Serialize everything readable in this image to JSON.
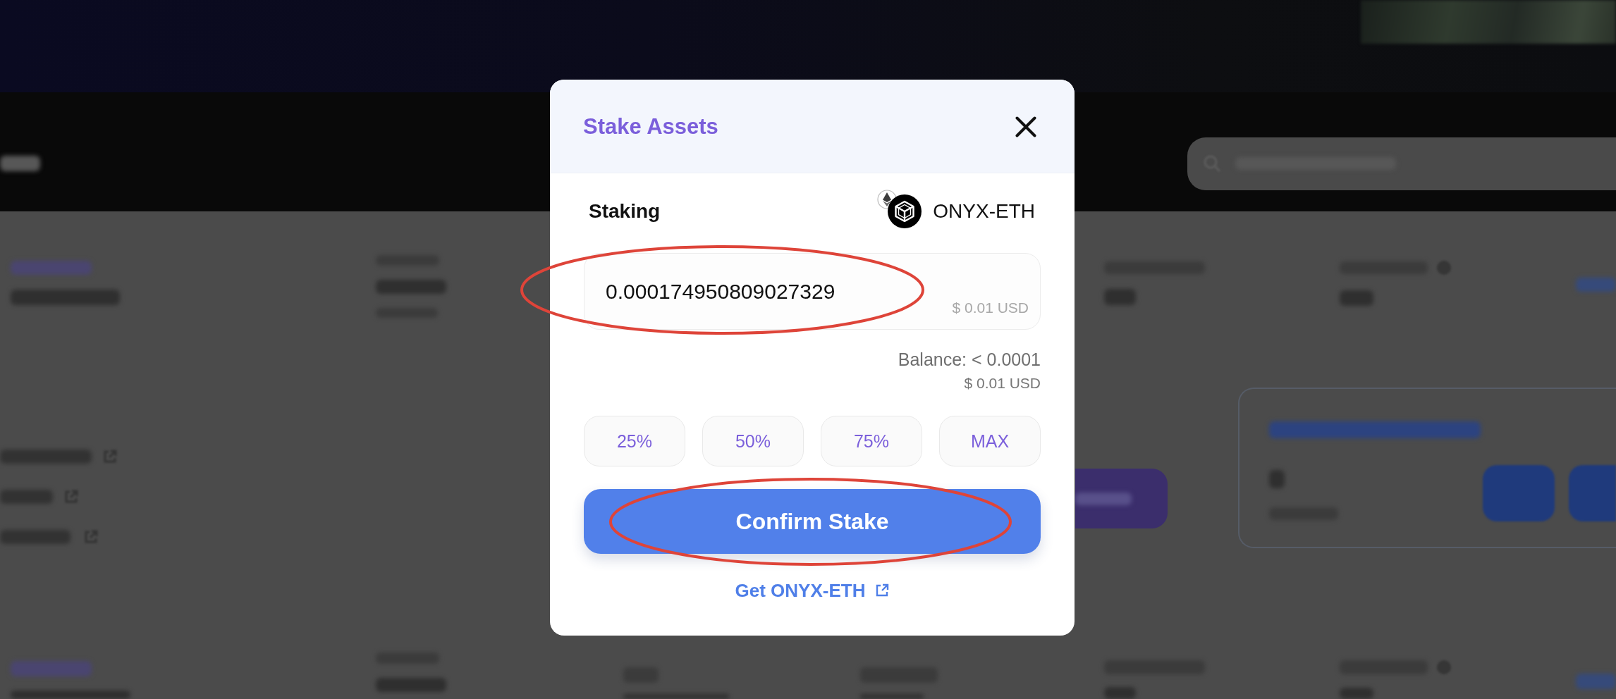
{
  "modal": {
    "title": "Stake Assets",
    "section_label": "Staking",
    "token": {
      "symbol": "ONYX-ETH"
    },
    "amount_field": {
      "value": "0.000174950809027329",
      "usd_value": "$ 0.01 USD",
      "highlighted": true
    },
    "balance": {
      "text": "Balance: < 0.0001",
      "usd_value": "$ 0.01 USD"
    },
    "preset_buttons": [
      {
        "label": "25%"
      },
      {
        "label": "50%"
      },
      {
        "label": "75%"
      },
      {
        "label": "MAX"
      }
    ],
    "confirm_button": {
      "label": "Confirm Stake",
      "highlighted": true
    },
    "token_link": {
      "label": "Get ONYX-ETH"
    }
  }
}
